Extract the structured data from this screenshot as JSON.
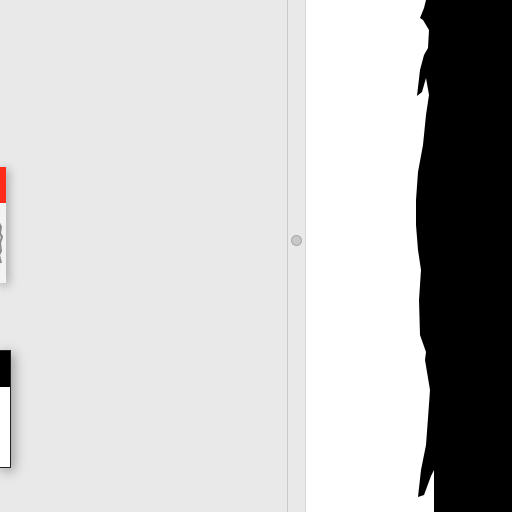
{
  "app": {
    "left_panel": {
      "thumbnails": [
        {
          "name": "thumbnail-red",
          "accent": "#ff2a1a"
        },
        {
          "name": "thumbnail-black-white",
          "accent": "#000000"
        }
      ]
    },
    "splitter": {
      "handle_icon": "grip-dot-icon"
    },
    "canvas": {
      "background": "#ffffff",
      "shape_color": "#000000"
    }
  }
}
